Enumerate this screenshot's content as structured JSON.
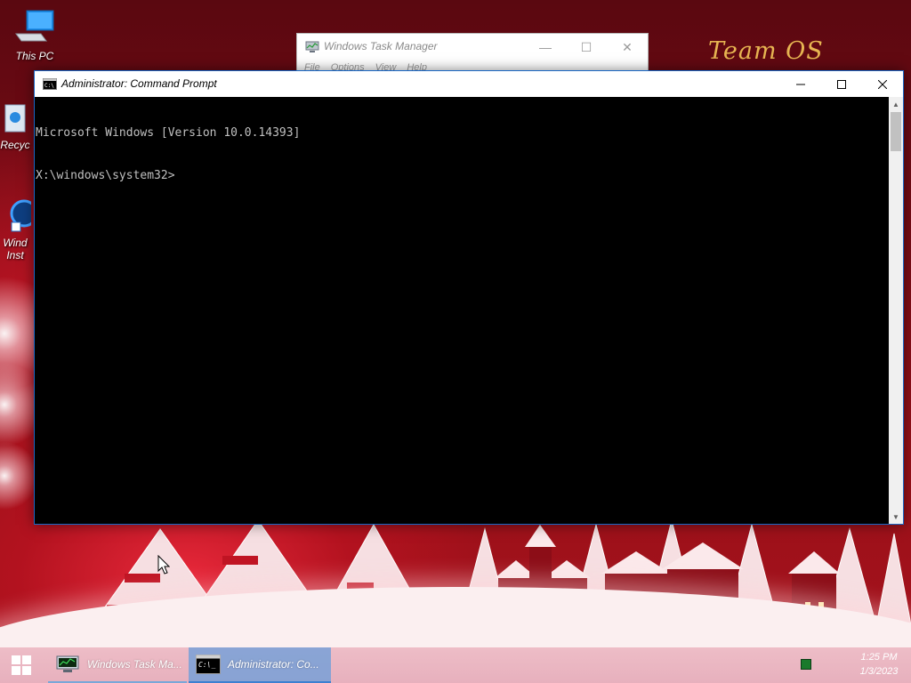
{
  "desktop": {
    "brand_text": "Team OS",
    "icons": [
      {
        "label": "This PC",
        "icon": "monitor-icon"
      },
      {
        "label": "Recyc",
        "icon": "recycle-bin-icon"
      },
      {
        "label": "Wind Inst",
        "icon": "windows-installer-icon"
      }
    ]
  },
  "task_manager": {
    "title": "Windows Task Manager",
    "menu": [
      "File",
      "Options",
      "View",
      "Help"
    ],
    "controls": {
      "minimize": "—",
      "maximize": "☐",
      "close": "✕"
    }
  },
  "cmd": {
    "title": "Administrator: Command Prompt",
    "lines": [
      "Microsoft Windows [Version 10.0.14393]",
      "",
      "X:\\windows\\system32>"
    ],
    "background": "#000000",
    "text_color": "#c0c0c0",
    "accent": "#1a67c5"
  },
  "taskbar": {
    "items": [
      {
        "label": "Windows Task Ma...",
        "icon": "task-manager-icon",
        "active": false
      },
      {
        "label": "Administrator: Co...",
        "icon": "cmd-icon",
        "active": true
      }
    ],
    "clock": {
      "time": "1:25 PM",
      "date": "1/3/2023"
    }
  }
}
